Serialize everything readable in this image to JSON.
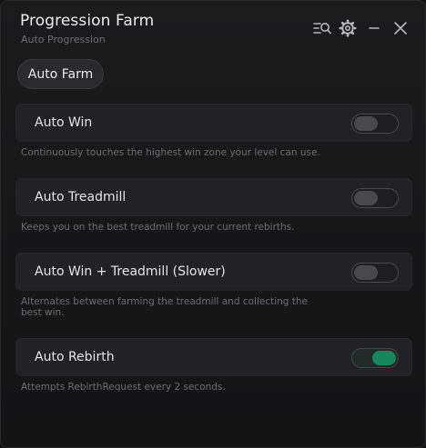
{
  "window": {
    "title": "Progression Farm",
    "subtitle": "Auto Progression",
    "controls": [
      "search-list-icon",
      "gear-icon",
      "minimize-icon",
      "close-icon"
    ]
  },
  "tabs": [
    {
      "label": "Auto Farm",
      "active": true
    }
  ],
  "options": [
    {
      "label": "Auto Win",
      "enabled": false,
      "description": "Continuously touches the highest win zone your level can use."
    },
    {
      "label": "Auto Treadmill",
      "enabled": false,
      "description": "Keeps you on the best treadmill for your current rebirths."
    },
    {
      "label": "Auto Win + Treadmill (Slower)",
      "enabled": false,
      "description": "Alternates between farming the treadmill and collecting the best win."
    },
    {
      "label": "Auto Rebirth",
      "enabled": true,
      "description": "Attempts RebirthRequest every 2 seconds."
    }
  ],
  "colors": {
    "accent_on": "#17865f",
    "background": "#161617",
    "card": "#222224"
  }
}
